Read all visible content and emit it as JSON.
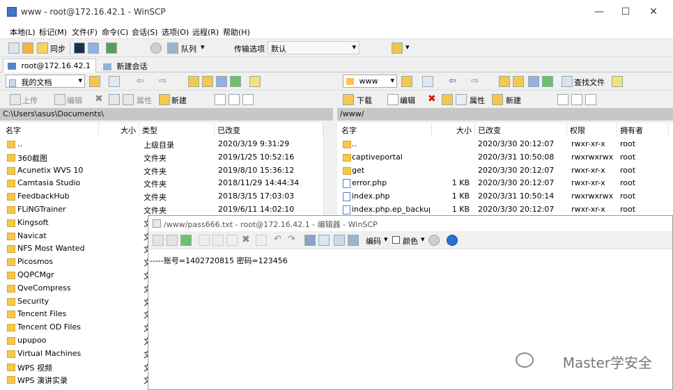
{
  "window": {
    "title": "www - root@172.16.42.1 - WinSCP"
  },
  "menu": [
    "本地(L)",
    "标记(M)",
    "文件(F)",
    "命令(C)",
    "会话(S)",
    "选项(O)",
    "远程(R)",
    "帮助(H)"
  ],
  "toolbar": {
    "sync_label": "同步",
    "queue_label": "队列",
    "transfer_label": "传输选项",
    "transfer_value": "默认"
  },
  "tabs": [
    {
      "label": "root@172.16.42.1"
    },
    {
      "label": "新建会话"
    }
  ],
  "left": {
    "location": "我的文档",
    "upload_label": "上传",
    "edit_label": "编辑",
    "props_label": "属性",
    "new_label": "新建",
    "path": "C:\\Users\\asus\\Documents\\",
    "headers": {
      "name": "名字",
      "size": "大小",
      "type": "类型",
      "changed": "已改变"
    },
    "rows": [
      {
        "name": "..",
        "type": "上级目录",
        "changed": "2020/3/19  9:31:29"
      },
      {
        "name": "360截图",
        "type": "文件夹",
        "changed": "2019/1/25  10:52:16"
      },
      {
        "name": "Acunetix WVS 10",
        "type": "文件夹",
        "changed": "2019/8/10  15:36:12"
      },
      {
        "name": "Camtasia Studio",
        "type": "文件夹",
        "changed": "2018/11/29  14:44:34"
      },
      {
        "name": "FeedbackHub",
        "type": "文件夹",
        "changed": "2018/3/15  17:03:03"
      },
      {
        "name": "FLiNGTrainer",
        "type": "文件夹",
        "changed": "2019/6/11  14:02:10"
      },
      {
        "name": "Kingsoft",
        "type": "文",
        "changed": ""
      },
      {
        "name": "Navicat",
        "type": "文",
        "changed": ""
      },
      {
        "name": "NFS Most Wanted",
        "type": "文",
        "changed": ""
      },
      {
        "name": "Picosmos",
        "type": "文",
        "changed": ""
      },
      {
        "name": "QQPCMgr",
        "type": "文",
        "changed": ""
      },
      {
        "name": "QveCompress",
        "type": "文",
        "changed": ""
      },
      {
        "name": "Security",
        "type": "文",
        "changed": ""
      },
      {
        "name": "Tencent Files",
        "type": "文",
        "changed": ""
      },
      {
        "name": "Tencent OD Files",
        "type": "文",
        "changed": ""
      },
      {
        "name": "upupoo",
        "type": "文",
        "changed": ""
      },
      {
        "name": "Virtual Machines",
        "type": "文",
        "changed": ""
      },
      {
        "name": "WPS 视频",
        "type": "文",
        "changed": ""
      },
      {
        "name": "WPS 演讲实录",
        "type": "文",
        "changed": ""
      }
    ]
  },
  "right": {
    "location": "www",
    "find_label": "查找文件",
    "download_label": "下载",
    "edit_label": "编辑",
    "props_label": "属性",
    "new_label": "新建",
    "path": "/www/",
    "headers": {
      "name": "名字",
      "size": "大小",
      "changed": "已改变",
      "rights": "权限",
      "owner": "拥有者"
    },
    "rows": [
      {
        "name": "..",
        "size": "",
        "changed": "2020/3/30 20:12:07",
        "rights": "rwxr-xr-x",
        "owner": "root",
        "kind": "up"
      },
      {
        "name": "captiveportal",
        "size": "",
        "changed": "2020/3/31 10:50:08",
        "rights": "rwxrwxrwx",
        "owner": "root",
        "kind": "folder"
      },
      {
        "name": "get",
        "size": "",
        "changed": "2020/3/30 20:12:07",
        "rights": "rwxr-xr-x",
        "owner": "root",
        "kind": "folder"
      },
      {
        "name": "error.php",
        "size": "1 KB",
        "changed": "2020/3/30 20:12:07",
        "rights": "rwxr-xr-x",
        "owner": "root",
        "kind": "file"
      },
      {
        "name": "index.php",
        "size": "1 KB",
        "changed": "2020/3/31 10:50:14",
        "rights": "rwxrwxrwx",
        "owner": "root",
        "kind": "file"
      },
      {
        "name": "index.php.ep_backup",
        "size": "1 KB",
        "changed": "2020/3/30 20:12:07",
        "rights": "rwxr-xr-x",
        "owner": "root",
        "kind": "file"
      }
    ]
  },
  "editor": {
    "title": "/www/pass666.txt - root@172.16.42.1 - 编辑器 - WinSCP",
    "encoding_label": "编码",
    "color_label": "颜色",
    "content": "-----账号=1402720815 密码=123456"
  },
  "watermark": "Master学安全"
}
